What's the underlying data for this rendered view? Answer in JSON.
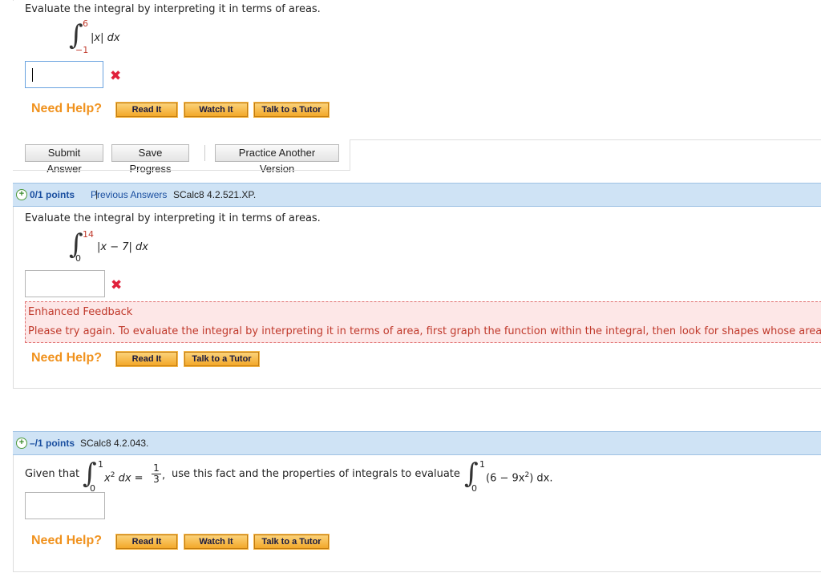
{
  "question1": {
    "prompt": "Evaluate the integral by interpreting it in terms of areas.",
    "upper": "6",
    "lower": "−1",
    "integrand": "|x| dx",
    "answer_value": ""
  },
  "help_label": "Need Help?",
  "buttons": {
    "read_it": "Read It",
    "watch_it": "Watch It",
    "talk_to_tutor": "Talk to a Tutor"
  },
  "actions": {
    "submit": "Submit Answer",
    "save": "Save Progress",
    "practice": "Practice Another Version"
  },
  "question2_header": {
    "points": "0/1 points",
    "separator": "|",
    "previous_answers": "Previous Answers",
    "code": "SCalc8 4.2.521.XP."
  },
  "question2": {
    "prompt": "Evaluate the integral by interpreting it in terms of areas.",
    "upper": "14",
    "lower": "0",
    "integrand": "|x − 7| dx",
    "answer_value": "",
    "feedback_title": "Enhanced Feedback",
    "feedback_text": "Please try again. To evaluate the integral by interpreting it in terms of area, first graph the function within the integral, then look for shapes whose area"
  },
  "question3_header": {
    "points": "–/1 points",
    "code": "SCalc8 4.2.043."
  },
  "question3": {
    "given": "Given that",
    "upper1": "1",
    "lower1": "0",
    "integrand1": "x",
    "exp1": "2",
    "dx1": " dx =",
    "frac_num": "1",
    "frac_den": "3",
    "comma": ",",
    "middle": "use this fact and the properties of integrals to evaluate",
    "upper2": "1",
    "lower2": "0",
    "integrand2a": "(6 − 9x",
    "exp2": "2",
    "integrand2b": ") dx.",
    "answer_value": ""
  },
  "colors": {
    "accent_orange": "#f0921e",
    "error_red": "#e0213b",
    "header_blue": "#cfe3f5",
    "link_blue": "#1a4fa0"
  }
}
